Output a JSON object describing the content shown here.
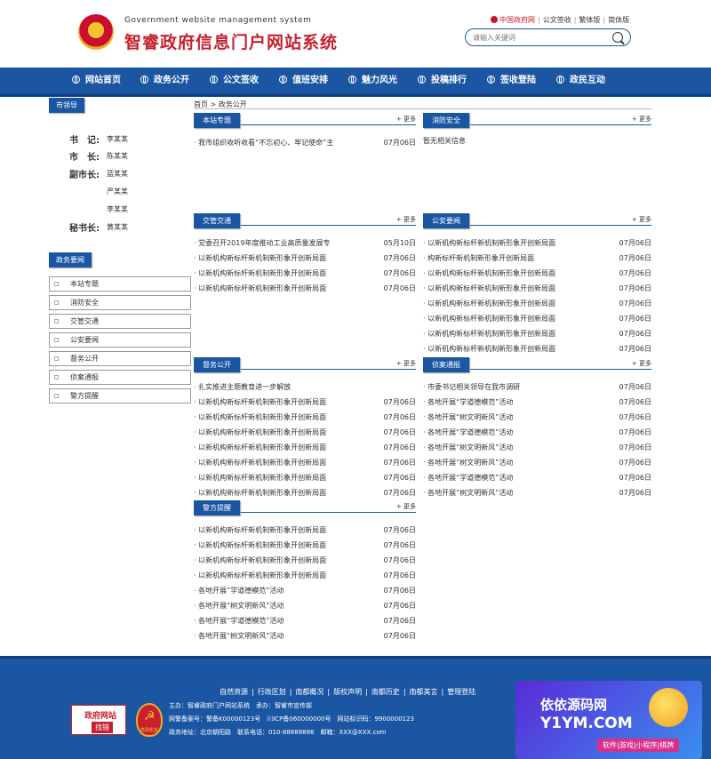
{
  "header": {
    "site_en": "Government website management system",
    "site_title": "智睿政府信息门户网站系统",
    "top_links": [
      "中国政府网",
      "公文签收",
      "繁体版",
      "简体版"
    ],
    "search_placeholder": "请输入关键词"
  },
  "nav": [
    "网站首页",
    "政务公开",
    "公文签收",
    "值班安排",
    "魅力风光",
    "投稿排行",
    "签收登陆",
    "政民互动"
  ],
  "sidebar": {
    "leaders_tab": "市领导",
    "leaders": [
      {
        "role": "书　记:",
        "name": "李某某"
      },
      {
        "role": "市　长:",
        "name": "陈某某"
      },
      {
        "role": "副市长:",
        "name": "蓝某某"
      },
      {
        "role": "",
        "name": "严某某"
      },
      {
        "role": "",
        "name": "李某某"
      },
      {
        "role": "秘书长:",
        "name": "黄某某"
      }
    ],
    "news_tab": "政务要闻",
    "items": [
      "本站专题",
      "消防安全",
      "交管交通",
      "公安要闻",
      "督务公开",
      "侦案通报",
      "警方提醒"
    ]
  },
  "breadcrumb": "首页 > 政务公开",
  "more_label": "+ 更多",
  "panels": [
    {
      "title": "本站专题",
      "items": [
        {
          "text": "· 我市组织收听收看“不忘初心、牢记使命”主",
          "date": "07月06日"
        }
      ]
    },
    {
      "title": "消防安全",
      "empty": "暂无相关信息",
      "items": []
    },
    {
      "title": "交管交通",
      "items": [
        {
          "text": "· 党委召开2019年度推动工业高质量发展专",
          "date": "05月10日"
        },
        {
          "text": "· 以新机构新标杆新机制新形象开创新局面",
          "date": "07月06日"
        },
        {
          "text": "· 以新机构新标杆新机制新形象开创新局面",
          "date": "07月06日"
        },
        {
          "text": "· 以新机构新标杆新机制新形象开创新局面",
          "date": "07月06日"
        }
      ]
    },
    {
      "title": "公安要闻",
      "items": [
        {
          "text": "· 以新机构新标杆新机制新形象开创新局面",
          "date": "07月06日"
        },
        {
          "text": "· 构新标杆新机制新形象开创新局面",
          "date": "07月06日"
        },
        {
          "text": "· 以新机构新标杆新机制新形象开创新局面",
          "date": "07月06日"
        },
        {
          "text": "· 以新机构新标杆新机制新形象开创新局面",
          "date": "07月06日"
        },
        {
          "text": "· 以新机构新标杆新机制新形象开创新局面",
          "date": "07月06日"
        },
        {
          "text": "· 以新机构新标杆新机制新形象开创新局面",
          "date": "07月06日"
        },
        {
          "text": "· 以新机构新标杆新机制新形象开创新局面",
          "date": "07月06日"
        },
        {
          "text": "· 以新机构新标杆新机制新形象开创新局面",
          "date": "07月06日"
        }
      ]
    },
    {
      "title": "督务公开",
      "items": [
        {
          "text": "· 扎实推进主题教育进一步解放",
          "date": ""
        },
        {
          "text": "· 以新机构新标杆新机制新形象开创新局面",
          "date": "07月06日"
        },
        {
          "text": "· 以新机构新标杆新机制新形象开创新局面",
          "date": "07月06日"
        },
        {
          "text": "· 以新机构新标杆新机制新形象开创新局面",
          "date": "07月06日"
        },
        {
          "text": "· 以新机构新标杆新机制新形象开创新局面",
          "date": "07月06日"
        },
        {
          "text": "· 以新机构新标杆新机制新形象开创新局面",
          "date": "07月06日"
        },
        {
          "text": "· 以新机构新标杆新机制新形象开创新局面",
          "date": "07月06日"
        },
        {
          "text": "· 以新机构新标杆新机制新形象开创新局面",
          "date": "07月06日"
        }
      ]
    },
    {
      "title": "侦案通报",
      "items": [
        {
          "text": "· 市委书记相关领导在我市调研",
          "date": "07月06日"
        },
        {
          "text": "· 各地开展“学道德模范”活动",
          "date": "07月06日"
        },
        {
          "text": "· 各地开展“树文明新风”活动",
          "date": "07月06日"
        },
        {
          "text": "· 各地开展“学道德模范”活动",
          "date": "07月06日"
        },
        {
          "text": "· 各地开展“树文明新风”活动",
          "date": "07月06日"
        },
        {
          "text": "· 各地开展“树文明新风”活动",
          "date": "07月06日"
        },
        {
          "text": "· 各地开展“学道德模范”活动",
          "date": "07月06日"
        },
        {
          "text": "· 各地开展“树文明新风”活动",
          "date": "07月06日"
        }
      ]
    },
    {
      "title": "警方提醒",
      "items": [
        {
          "text": "· 以新机构新标杆新机制新形象开创新局面",
          "date": "07月06日"
        },
        {
          "text": "· 以新机构新标杆新机制新形象开创新局面",
          "date": "07月06日"
        },
        {
          "text": "· 以新机构新标杆新机制新形象开创新局面",
          "date": "07月06日"
        },
        {
          "text": "· 以新机构新标杆新机制新形象开创新局面",
          "date": "07月06日"
        },
        {
          "text": "· 各地开展“学道德模范”活动",
          "date": "07月06日"
        },
        {
          "text": "· 各地开展“树文明新风”活动",
          "date": "07月06日"
        },
        {
          "text": "· 各地开展“学道德模范”活动",
          "date": "07月06日"
        },
        {
          "text": "· 各地开展“树文明新风”活动",
          "date": "07月06日"
        }
      ]
    }
  ],
  "footer": {
    "links": [
      "自然资源",
      "行政区划",
      "南都概况",
      "版权声明",
      "南都历史",
      "南都美言",
      "管理登陆"
    ],
    "badge_gov_line1": "政府网站",
    "badge_gov_line2": "找错",
    "badge_party_label": "党政机关",
    "host": "主办：智睿政府门户网站系统　承办：智睿市宣传部",
    "icp": "网警备案号：警备K00000123号　川ICP备060000000号　网站标识码：9900000123",
    "address": "政务地址：北京朝阳路　联系电话：010-88888886　邮箱：XXX@XXX.com"
  },
  "watermark": {
    "line1": "依依源码网",
    "line2": "Y1YM.COM",
    "line3": "软件|游戏|小程序|棋牌"
  }
}
